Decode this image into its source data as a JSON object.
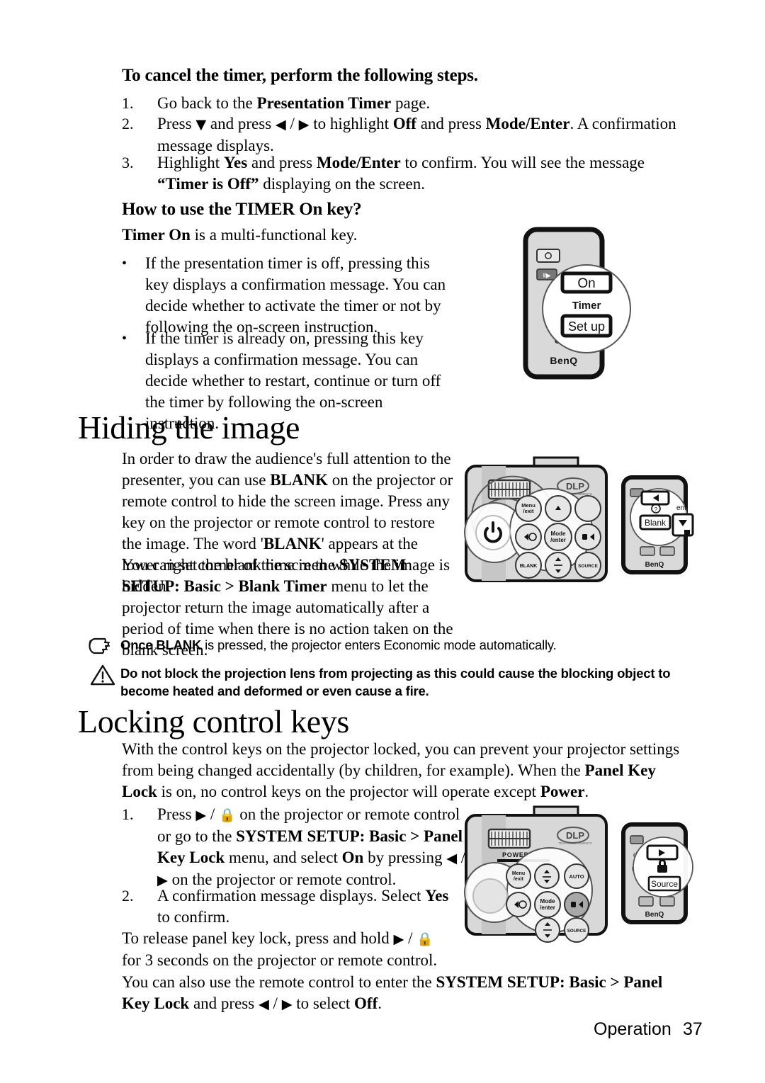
{
  "page": {
    "footer_label": "Operation",
    "footer_number": "37"
  },
  "section_timer": {
    "heading": "To cancel the timer, perform the following steps.",
    "steps": [
      {
        "num": "1.",
        "parts": [
          {
            "t": "Go back to the ",
            "b": false
          },
          {
            "t": "Presentation Timer",
            "b": true
          },
          {
            "t": " page.",
            "b": false
          }
        ]
      },
      {
        "num": "2.",
        "parts": [
          {
            "t": "Press ",
            "b": false
          },
          {
            "t": "▼",
            "b": false,
            "sym": true
          },
          {
            "t": " and press ",
            "b": false
          },
          {
            "t": "◀",
            "b": false,
            "sym": true
          },
          {
            "t": " / ",
            "b": false
          },
          {
            "t": "▶",
            "b": false,
            "sym": true
          },
          {
            "t": " to highlight ",
            "b": false
          },
          {
            "t": "Off",
            "b": true
          },
          {
            "t": " and press ",
            "b": false
          },
          {
            "t": "Mode/Enter",
            "b": true
          },
          {
            "t": ". A confirmation message displays.",
            "b": false
          }
        ]
      },
      {
        "num": "3.",
        "parts": [
          {
            "t": "Highlight ",
            "b": false
          },
          {
            "t": "Yes",
            "b": true
          },
          {
            "t": " and press ",
            "b": false
          },
          {
            "t": "Mode/Enter",
            "b": true
          },
          {
            "t": " to confirm. You will see the message ",
            "b": false
          },
          {
            "t": "“Timer is Off”",
            "b": true
          },
          {
            "t": " displaying on the screen.",
            "b": false
          }
        ]
      }
    ]
  },
  "section_timer_key": {
    "heading": "How to use the TIMER On key?",
    "intro_bold": "Timer On",
    "intro_rest": " is a multi-functional key.",
    "bullets": [
      "If the presentation timer is off, pressing this key displays a confirmation message. You can decide whether to activate the timer or not by following the on-screen instruction.",
      "If the timer is already on, pressing this key displays a confirmation message. You can decide whether to restart, continue or turn off the timer by following the on-screen instruction."
    ],
    "remote": {
      "button_on": "On",
      "label_timer": "Timer",
      "button_setup": "Set up",
      "brand": "BenQ"
    }
  },
  "section_hiding": {
    "heading": "Hiding the image",
    "para1": [
      {
        "t": "In order to draw the audience's full attention to the presenter, you can use ",
        "b": false
      },
      {
        "t": "BLANK",
        "b": true
      },
      {
        "t": " on the projector or remote control to hide the screen image. Press any key on the projector or remote control to restore the image. The word '",
        "b": false
      },
      {
        "t": "BLANK",
        "b": true
      },
      {
        "t": "' appears at the lower right corner of the screen while the image is hidden.",
        "b": false
      }
    ],
    "para2": [
      {
        "t": "You can set the blank time in the ",
        "b": false
      },
      {
        "t": "SYSTEM SETUP: Basic > Blank Timer",
        "b": true
      },
      {
        "t": " menu to let the projector return the image automatically after a period of time when there is no action taken on the blank screen.",
        "b": false
      }
    ],
    "projector": {
      "logo": "DLP",
      "logo_sub": "TEXAS INSTRUMENTS",
      "btn_menu": "Menu",
      "btn_menu2": "/exit",
      "btn_mode": "Mode",
      "btn_mode2": "/enter",
      "btn_blank": "BLANK",
      "btn_source": "SOURCE"
    },
    "remote": {
      "btn_blank": "Blank",
      "label_enter": "ent",
      "brand": "BenQ"
    }
  },
  "notes": [
    {
      "icon": "pointing-hand-icon",
      "parts": [
        {
          "t": "Once BLANK",
          "b": true
        },
        {
          "t": " is pressed, the projector enters Economic mode automatically.",
          "b": false
        }
      ]
    },
    {
      "icon": "warning-triangle-icon",
      "parts": [
        {
          "t": "Do not block the projection lens from projecting as this could cause the blocking object to become heated and deformed or even cause a fire.",
          "b": true
        }
      ]
    }
  ],
  "section_locking": {
    "heading": "Locking control keys",
    "intro": [
      {
        "t": "With the control keys on the projector locked, you can prevent your projector settings from being changed accidentally (by children, for example). When the ",
        "b": false
      },
      {
        "t": "Panel Key Lock",
        "b": true
      },
      {
        "t": " is on, no control keys on the projector will operate except ",
        "b": false
      },
      {
        "t": "Power",
        "b": true
      },
      {
        "t": ".",
        "b": false
      }
    ],
    "steps": [
      {
        "num": "1.",
        "parts": [
          {
            "t": "Press ",
            "b": false
          },
          {
            "t": "▶",
            "b": false,
            "sym": true
          },
          {
            "t": " / ",
            "b": false
          },
          {
            "t": "🔒",
            "b": false,
            "lock": true
          },
          {
            "t": " on the projector or remote control or go to the ",
            "b": false
          },
          {
            "t": "SYSTEM SETUP: Basic > Panel Key Lock",
            "b": true
          },
          {
            "t": " menu, and select ",
            "b": false
          },
          {
            "t": "On",
            "b": true
          },
          {
            "t": " by pressing ",
            "b": false
          },
          {
            "t": "◀",
            "b": false,
            "sym": true
          },
          {
            "t": " / ",
            "b": false
          },
          {
            "t": "▶",
            "b": false,
            "sym": true
          },
          {
            "t": " on the projector or remote control.",
            "b": false
          }
        ]
      },
      {
        "num": "2.",
        "parts": [
          {
            "t": "A confirmation message displays. Select ",
            "b": false
          },
          {
            "t": "Yes",
            "b": true
          },
          {
            "t": " to confirm.",
            "b": false
          }
        ]
      }
    ],
    "para_release": [
      {
        "t": "To release panel key lock, press and hold ",
        "b": false
      },
      {
        "t": "▶",
        "b": false,
        "sym": true
      },
      {
        "t": " / ",
        "b": false
      },
      {
        "t": "🔒",
        "b": false,
        "lock": true
      },
      {
        "t": " for 3 seconds on the projector or remote control.",
        "b": false
      }
    ],
    "para_remote": [
      {
        "t": "You can also use the remote control to enter the ",
        "b": false
      },
      {
        "t": "SYSTEM SETUP: Basic > Panel Key Lock",
        "b": true
      },
      {
        "t": " and press ",
        "b": false
      },
      {
        "t": "◀",
        "b": false,
        "sym": true
      },
      {
        "t": " / ",
        "b": false
      },
      {
        "t": "▶",
        "b": false,
        "sym": true
      },
      {
        "t": " to select ",
        "b": false
      },
      {
        "t": "Off",
        "b": true
      },
      {
        "t": ".",
        "b": false
      }
    ],
    "projector": {
      "logo": "DLP",
      "logo_sub": "TEXAS INSTRUMENTS",
      "label_power": "POWER",
      "btn_menu": "Menu",
      "btn_menu2": "/exit",
      "btn_auto": "AUTO",
      "btn_mode": "Mode",
      "btn_mode2": "/enter",
      "btn_source": "SOURCE"
    },
    "remote": {
      "label_de": "de",
      "label_ter": "ter",
      "btn_source": "Source",
      "brand": "BenQ"
    }
  }
}
